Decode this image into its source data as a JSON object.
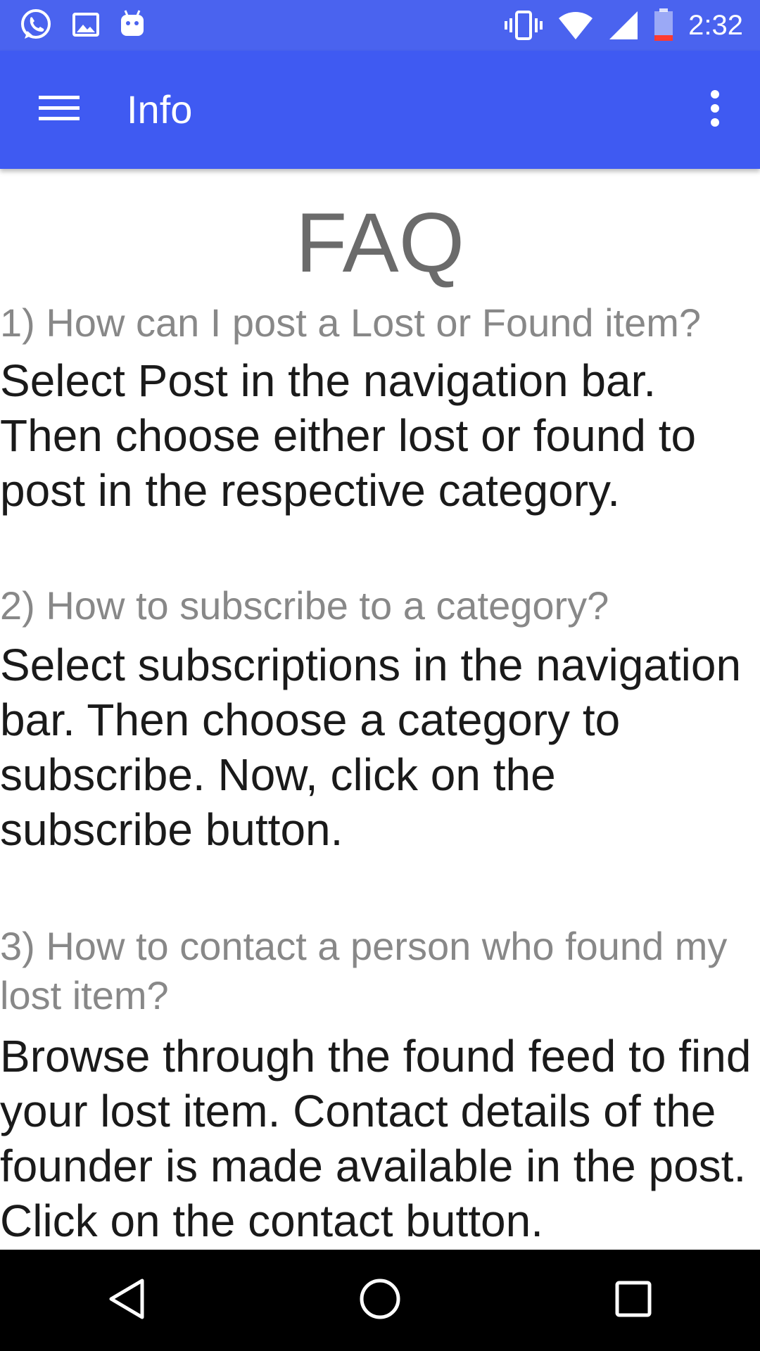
{
  "status_bar": {
    "icons_left": [
      "whatsapp-icon",
      "gallery-icon",
      "android-icon"
    ],
    "icons_right": [
      "vibrate-icon",
      "wifi-icon",
      "signal-icon",
      "battery-icon"
    ],
    "time": "2:32"
  },
  "app_bar": {
    "title": "Info",
    "menu_icon": "hamburger-menu-icon",
    "overflow_icon": "more-vert-icon"
  },
  "content": {
    "title": "FAQ",
    "faqs": [
      {
        "question": "1) How can I post a Lost or Found item?",
        "answer": " Select Post in the navigation bar. Then choose either lost or found to post in the respective category."
      },
      {
        "question": "2) How to subscribe to a category?",
        "answer": "Select subscriptions in the navigation bar. Then choose a category to subscribe. Now, click on the subscribe button."
      },
      {
        "question": "3) How to contact a person who found my lost item?",
        "answer": "Browse through the found feed to find your lost item. Contact details of the founder is made available in the post. Click on the  contact button."
      }
    ]
  },
  "nav_bar": {
    "buttons": [
      "back-icon",
      "home-icon",
      "recents-icon"
    ]
  },
  "colors": {
    "status_bar": "#4a63ef",
    "app_bar": "#3f5af2",
    "question_text": "#888888",
    "answer_text": "#1a1a1a",
    "title_text": "#6b6b6b"
  }
}
